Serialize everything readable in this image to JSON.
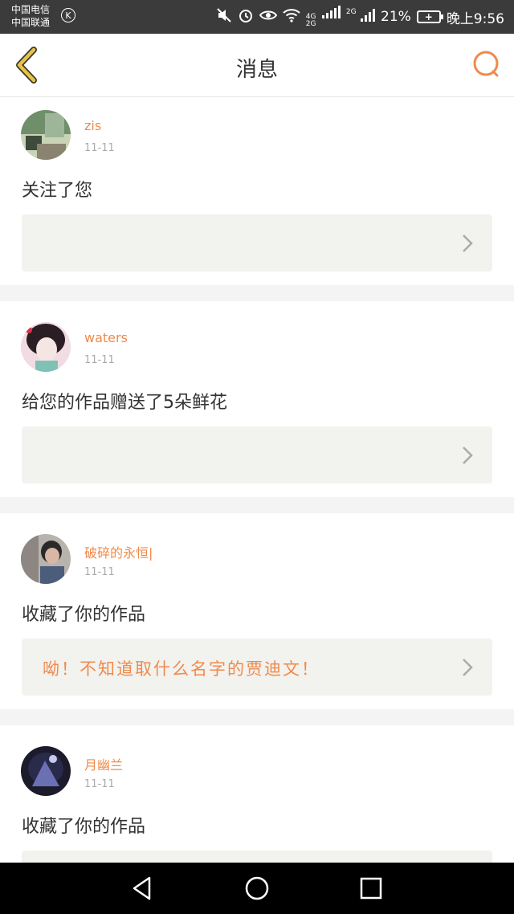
{
  "status_bar": {
    "carrier1": "中国电信",
    "carrier2": "中国联通",
    "carrier_badge": "K",
    "net1": "4G",
    "net2": "2G",
    "net3": "2G",
    "battery_percent": "21%",
    "battery_symbol": "+",
    "time": "晚上9:56",
    "icons": [
      "mute-icon",
      "alarm-icon",
      "eye-icon",
      "wifi-icon",
      "signal-icon",
      "battery-icon"
    ]
  },
  "header": {
    "title": "消息",
    "back_icon": "chevron-left-icon",
    "search_icon": "search-icon",
    "accent": "#f08a4b",
    "back_color": "#e8c24a"
  },
  "messages": [
    {
      "username": "zis",
      "date": "11-11",
      "action": "关注了您",
      "work_text": "",
      "avatar_colors": [
        "#6f8f6a",
        "#c9d3b6",
        "#3e4a3c"
      ]
    },
    {
      "username": "waters",
      "date": "11-11",
      "action": "给您的作品赠送了5朵鲜花",
      "work_text": "",
      "avatar_colors": [
        "#f1dce2",
        "#2b1d24",
        "#e7a8b6"
      ]
    },
    {
      "username": "破碎的永恒|",
      "date": "11-11",
      "action": "收藏了你的作品",
      "work_text": "呦！不知道取什么名字的贾迪文！",
      "avatar_colors": [
        "#b9b3ad",
        "#4b5d7a",
        "#2b2a2a"
      ]
    },
    {
      "username": "月幽兰",
      "date": "11-11",
      "action": "收藏了你的作品",
      "work_text": "",
      "avatar_colors": [
        "#2a2a4a",
        "#6b6fb4",
        "#1b1b2b"
      ]
    }
  ],
  "nav_bar": {
    "icons": [
      "back-triangle-icon",
      "home-circle-icon",
      "recents-square-icon"
    ]
  }
}
